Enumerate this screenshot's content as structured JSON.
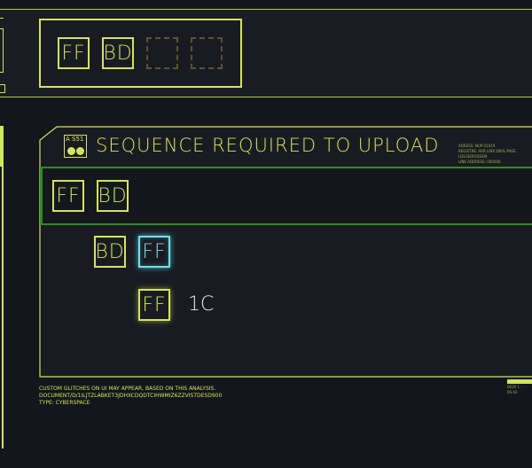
{
  "buffer": {
    "slots": [
      {
        "code": "FF",
        "state": "filled"
      },
      {
        "code": "BD",
        "state": "filled"
      },
      {
        "code": "",
        "state": "empty"
      },
      {
        "code": "",
        "state": "empty"
      }
    ]
  },
  "panel": {
    "badge": {
      "label": "A S51"
    },
    "title": "SEQUENCE REQUIRED TO UPLOAD",
    "meta_lines": [
      "ADRESS: NUP-01019",
      "REGISTRE: ARR LINX DRVL PAGE",
      "LDS-DEROSSI09",
      "LINK ADDRESS: 000000"
    ],
    "rows": [
      {
        "cells": [
          {
            "code": "FF",
            "state": "done"
          },
          {
            "code": "BD",
            "state": "done"
          }
        ]
      },
      {
        "cells": [
          {
            "code": "BD",
            "state": "done"
          },
          {
            "code": "FF",
            "state": "active"
          }
        ]
      },
      {
        "cells": [
          {
            "code": "FF",
            "state": "glow"
          }
        ],
        "suffix": "1C"
      }
    ]
  },
  "footer": {
    "lines": [
      "CUSTOM GLITCHES ON UI MAY APPEAR, BASED ON THIS ANALYSIS.",
      "DOCUMENT/D/1ILJTZLABKET3JDHXCDQDTCIHWMIZ6ZZVISTDESD900",
      "TYPE: CYBERSPACE"
    ]
  },
  "right_tag": {
    "lines": [
      "0020 1 · ·",
      "0S:42"
    ]
  },
  "colors": {
    "accent": "#d2e55f",
    "active": "#79dbe6",
    "highlight_border": "#2f8b27",
    "background": "#14151d"
  }
}
